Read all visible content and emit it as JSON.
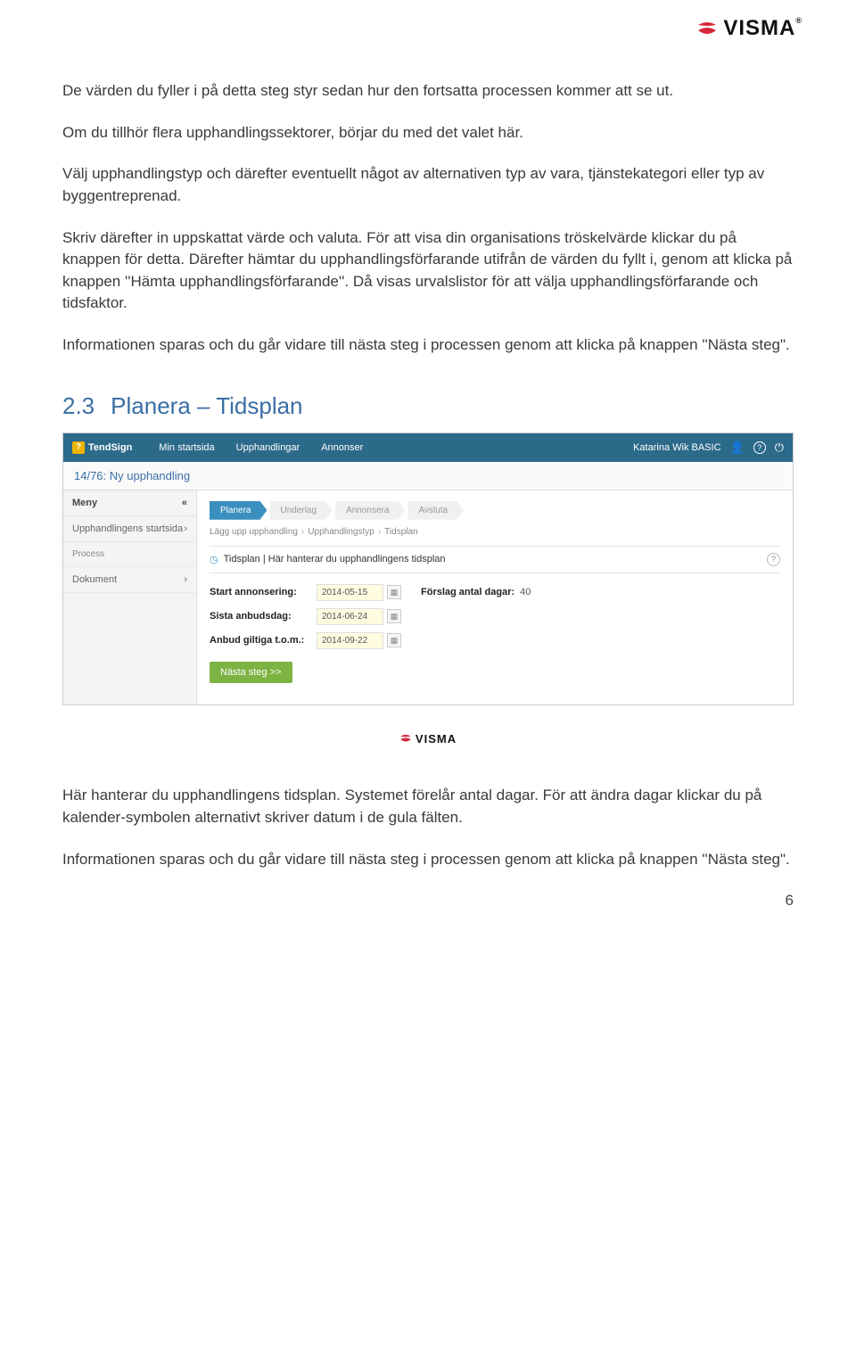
{
  "logo": {
    "brand": "VISMA",
    "tm": "®"
  },
  "paragraphs": {
    "p1": "De värden du fyller i på detta steg styr sedan hur den fortsatta processen kommer att se ut.",
    "p2": "Om du tillhör flera upphandlingssektorer, börjar du med det valet här.",
    "p3": "Välj upphandlingstyp och därefter eventuellt något av alternativen typ av vara, tjänstekategori eller typ av byggentreprenad.",
    "p4": "Skriv därefter in uppskattat värde och valuta. För att visa din organisations tröskelvärde klickar du på knappen för detta. Därefter hämtar du upphandlingsförfarande utifrån de värden du fyllt i, genom att klicka på knappen ''Hämta upphandlingsförfarande''. Då visas urvalslistor för att välja upphandlingsförfarande och tidsfaktor.",
    "p5": "Informationen sparas och du går vidare till nästa steg i processen genom att klicka på knappen ''Nästa steg\"."
  },
  "section": {
    "num": "2.3",
    "title": "Planera – Tidsplan"
  },
  "app": {
    "brand": "TendSign",
    "nav": {
      "home": "Min startsida",
      "upph": "Upphandlingar",
      "ann": "Annonser"
    },
    "user": "Katarina Wik BASIC",
    "subtitle": "14/76: Ny upphandling",
    "sidebar": {
      "menu": "Meny",
      "start": "Upphandlingens startsida",
      "process": "Process",
      "dokument": "Dokument"
    },
    "steps": {
      "s1": "Planera",
      "s2": "Underlag",
      "s3": "Annonsera",
      "s4": "Avsluta"
    },
    "crumbs": {
      "c1": "Lägg upp upphandling",
      "c2": "Upphandlingstyp",
      "c3": "Tidsplan"
    },
    "panel_title": "Tidsplan  |  Här hanterar du upphandlingens tidsplan",
    "form": {
      "start_label": "Start annonsering:",
      "start_value": "2014-05-15",
      "suggest_label": "Förslag antal dagar:",
      "suggest_value": "40",
      "last_label": "Sista anbudsdag:",
      "last_value": "2014-06-24",
      "valid_label": "Anbud giltiga t.o.m.:",
      "valid_value": "2014-09-22",
      "next_btn": "Nästa steg >>"
    }
  },
  "after": {
    "p1": "Här hanterar du upphandlingens tidsplan. Systemet förelår antal dagar. För att ändra dagar klickar du på kalender-symbolen alternativt skriver datum i de gula fälten.",
    "p2": "Informationen sparas och du går vidare till nästa steg i processen genom att klicka på knappen ''Nästa steg\"."
  },
  "page_number": "6"
}
